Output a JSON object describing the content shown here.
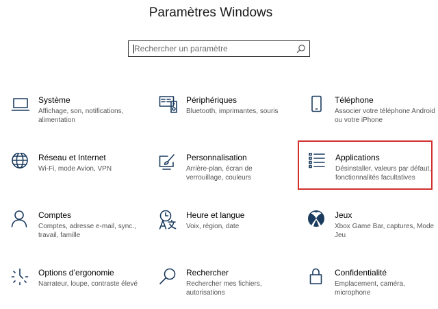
{
  "window": {
    "title": "Paramètres Windows"
  },
  "search": {
    "placeholder": "Rechercher un paramètre",
    "icon": "search-icon"
  },
  "accent_color": "#1b3b5e",
  "highlight_color": "#d32f2f",
  "tiles": [
    {
      "id": "systeme",
      "title": "Système",
      "desc": "Affichage, son, notifications, alimentation",
      "icon": "laptop-icon"
    },
    {
      "id": "peripheriques",
      "title": "Périphériques",
      "desc": "Bluetooth, imprimantes, souris",
      "icon": "devices-icon"
    },
    {
      "id": "telephone",
      "title": "Téléphone",
      "desc": "Associer votre téléphone Android ou votre iPhone",
      "icon": "phone-icon"
    },
    {
      "id": "reseau",
      "title": "Réseau et Internet",
      "desc": "Wi-Fi, mode Avion, VPN",
      "icon": "globe-icon"
    },
    {
      "id": "personnalisation",
      "title": "Personnalisation",
      "desc": "Arrière-plan, écran de verrouillage, couleurs",
      "icon": "brush-icon"
    },
    {
      "id": "applications",
      "title": "Applications",
      "desc": "Désinstaller, valeurs par défaut, fonctionnalités facultatives",
      "icon": "apps-list-icon",
      "highlighted": true
    },
    {
      "id": "comptes",
      "title": "Comptes",
      "desc": "Comptes, adresse e-mail, sync., travail, famille",
      "icon": "person-icon"
    },
    {
      "id": "heure",
      "title": "Heure et langue",
      "desc": "Voix, région, date",
      "icon": "time-language-icon"
    },
    {
      "id": "jeux",
      "title": "Jeux",
      "desc": "Xbox Game Bar, captures, Mode Jeu",
      "icon": "xbox-icon"
    },
    {
      "id": "ergonomie",
      "title": "Options d’ergonomie",
      "desc": "Narrateur, loupe, contraste élevé",
      "icon": "ease-of-access-icon"
    },
    {
      "id": "rechercher",
      "title": "Rechercher",
      "desc": "Rechercher mes fichiers, autorisations",
      "icon": "magnifier-icon"
    },
    {
      "id": "confidentialite",
      "title": "Confidentialité",
      "desc": "Emplacement, caméra, microphone",
      "icon": "lock-icon"
    }
  ]
}
